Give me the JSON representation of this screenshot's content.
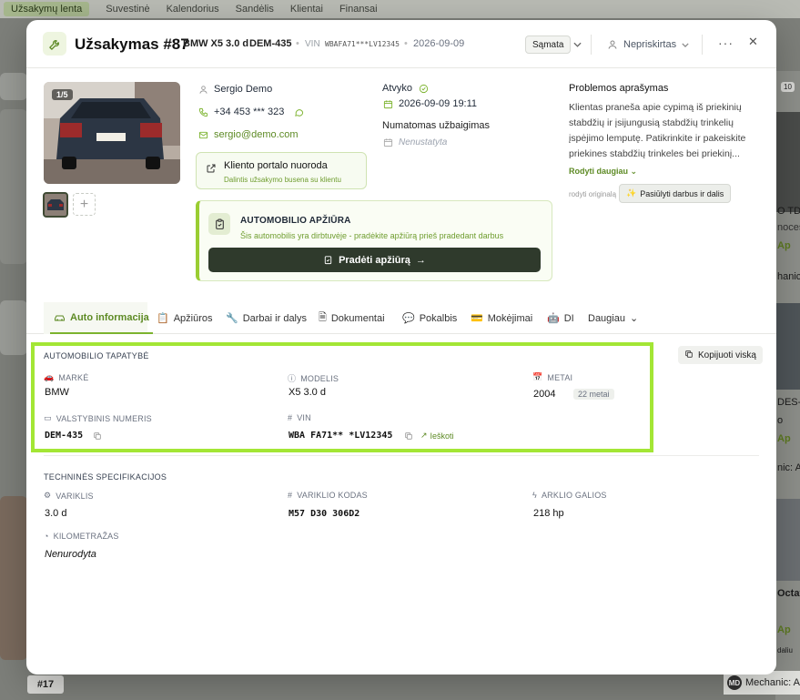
{
  "bg": {
    "nav": [
      "Užsakymų lenta",
      "Suvestinė",
      "Kalendorius",
      "Sandėlis",
      "Klientai",
      "Finansai"
    ],
    "side_badge": "10",
    "right_texts": [
      "O TDI",
      "noces",
      "Ap",
      "hanic: Au",
      "DES-B",
      "o",
      "Ap",
      "nic: Au",
      "Octavi",
      "Ap",
      "daliu",
      "Mechanic: Au"
    ],
    "bottom_tag": "#17",
    "bottom_mech": "Mechanic: A",
    "md_badge": "MD"
  },
  "header": {
    "title": "Užsakymas #87",
    "car": "BMW X5 3.0 d",
    "plate": "DEM-435",
    "vin_label": "VIN",
    "vin": "WBAFA71***LV12345",
    "date": "2026-09-09",
    "quote_label": "Sąmata",
    "assignee": "Nepriskirtas"
  },
  "photo": {
    "counter": "1/5",
    "plate_text": "DEM 435"
  },
  "customer": {
    "name": "Sergio Demo",
    "phone": "+34 453 *** 323",
    "email": "sergio@demo.com",
    "portal_title": "Kliento portalo nuoroda",
    "portal_sub": "Dalintis užsakymo busena su klientu"
  },
  "status": {
    "arrived_label": "Atvyko",
    "arrived_value": "2026-09-09 19:11",
    "due_label": "Numatomas užbaigimas",
    "due_value": "Nenustatyta"
  },
  "inspection": {
    "title": "AUTOMOBILIO APŽIŪRA",
    "subtitle": "Šis automobilis yra dirbtuvėje - pradėkite apžiūrą prieš pradedant darbus",
    "button": "Pradėti apžiūrą"
  },
  "problem": {
    "title": "Problemos aprašymas",
    "lines": [
      "Klientas praneša apie cypimą iš priekinių",
      "stabdžių ir įsijungusią stabdžių trinkelių",
      "įspėjimo lemputę. Patikrinkite ir pakeiskite",
      "priekines stabdžių trinkeles bei priekinį..."
    ],
    "show_more": "Rodyti daugiau",
    "original": "rodyti originalą",
    "suggest": "Pasiūlyti darbus ir dalis"
  },
  "tabs": [
    "Auto informacija",
    "Apžiūros",
    "Darbai ir dalys",
    "Dokumentai",
    "Pokalbis",
    "Mokėjimai",
    "DI",
    "Daugiau"
  ],
  "identity": {
    "title": "AUTOMOBILIO TAPATYBĖ",
    "copy_all": "Kopijuoti viską",
    "make_label": "MARKĖ",
    "make": "BMW",
    "model_label": "MODELIS",
    "model": "X5 3.0 d",
    "year_label": "METAI",
    "year": "2004",
    "age": "22 metai",
    "plate_label": "VALSTYBINIS NUMERIS",
    "plate": "DEM-435",
    "vin_label": "VIN",
    "vin": "WBA FA71** *LV12345",
    "search": "Ieškoti"
  },
  "specs": {
    "title": "TECHNINĖS SPECIFIKACIJOS",
    "engine_label": "VARIKLIS",
    "engine": "3.0 d",
    "code_label": "VARIKLIO KODAS",
    "code": "M57 D30 306D2",
    "power_label": "ARKLIO GALIOS",
    "power": "218 hp",
    "mileage_label": "KILOMETRAŽAS",
    "mileage": "Nenurodyta"
  },
  "colors": {
    "accent": "#7cb32e",
    "highlight": "#a3e635",
    "dark_button": "#2f3a2c"
  }
}
